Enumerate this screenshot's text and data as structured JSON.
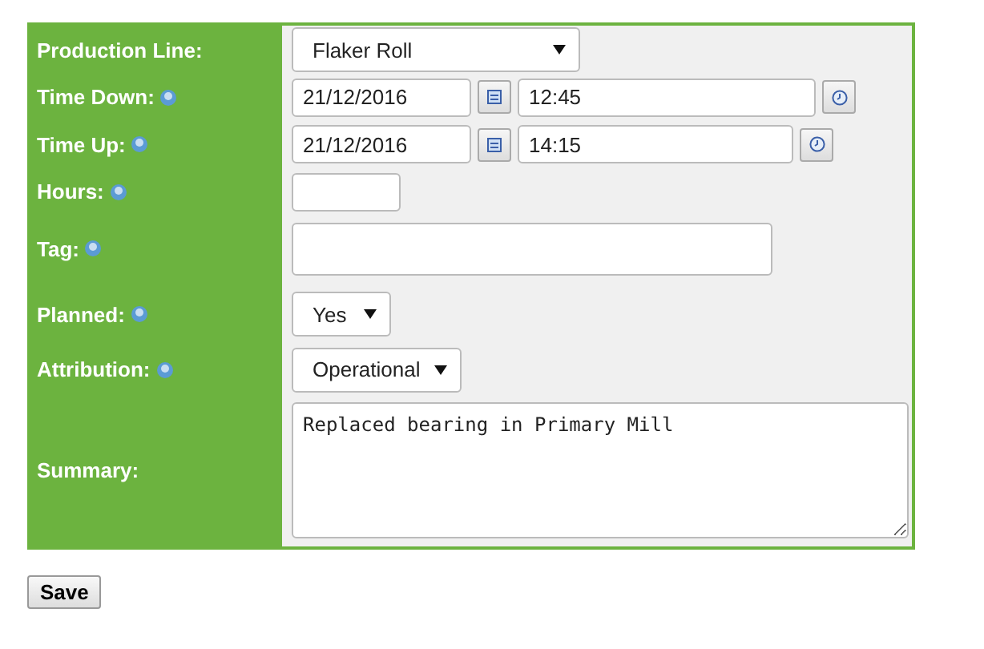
{
  "form": {
    "fields": [
      {
        "label": "Production Line:",
        "help": false,
        "kind": "select",
        "value": "Flaker Roll"
      },
      {
        "label": "Time Down:",
        "help": true,
        "kind": "datetime",
        "date": "21/12/2016",
        "time": "12:45"
      },
      {
        "label": "Time Up:",
        "help": true,
        "kind": "datetime",
        "date": "21/12/2016",
        "time": "14:15"
      },
      {
        "label": "Hours:",
        "help": true,
        "kind": "text"
      },
      {
        "label": "Tag:",
        "help": true,
        "kind": "text"
      },
      {
        "label": "Planned:",
        "help": true,
        "kind": "select",
        "value": "Yes"
      },
      {
        "label": "Attribution:",
        "help": true,
        "kind": "select",
        "value": "Operational"
      },
      {
        "label": "Summary:",
        "help": false,
        "kind": "textarea",
        "value": "Replaced bearing in Primary Mill"
      }
    ]
  },
  "buttons": [
    {
      "label": "Save"
    }
  ]
}
